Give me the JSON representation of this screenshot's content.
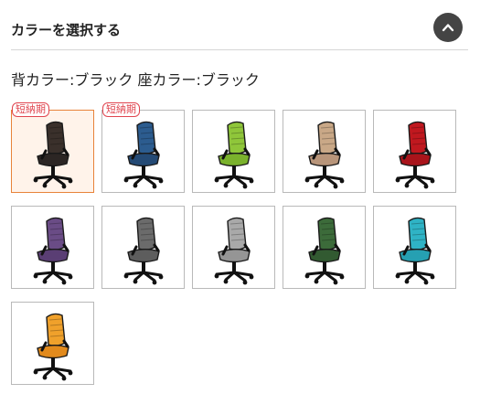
{
  "header": {
    "title": "カラーを選択する"
  },
  "selection_text": "背カラー:ブラック 座カラー:ブラック",
  "swatches": [
    {
      "back": "#3a302b",
      "seat": "#2c2624",
      "badge": "短納期",
      "selected": true
    },
    {
      "back": "#2c5c8f",
      "seat": "#244a75",
      "badge": "短納期",
      "selected": false
    },
    {
      "back": "#8fc63a",
      "seat": "#7ab22c",
      "badge": "",
      "selected": false
    },
    {
      "back": "#c9a887",
      "seat": "#b8957a",
      "badge": "",
      "selected": false
    },
    {
      "back": "#c0181f",
      "seat": "#a9141b",
      "badge": "",
      "selected": false
    },
    {
      "back": "#6a4c86",
      "seat": "#5a3e74",
      "badge": "",
      "selected": false
    },
    {
      "back": "#6b6b6b",
      "seat": "#5d5d5d",
      "badge": "",
      "selected": false
    },
    {
      "back": "#a9a9a9",
      "seat": "#959595",
      "badge": "",
      "selected": false
    },
    {
      "back": "#3c6b3a",
      "seat": "#325a31",
      "badge": "",
      "selected": false
    },
    {
      "back": "#2fb3c5",
      "seat": "#26a0b2",
      "badge": "",
      "selected": false
    },
    {
      "back": "#f0a12b",
      "seat": "#e28a1c",
      "badge": "",
      "selected": false
    }
  ]
}
